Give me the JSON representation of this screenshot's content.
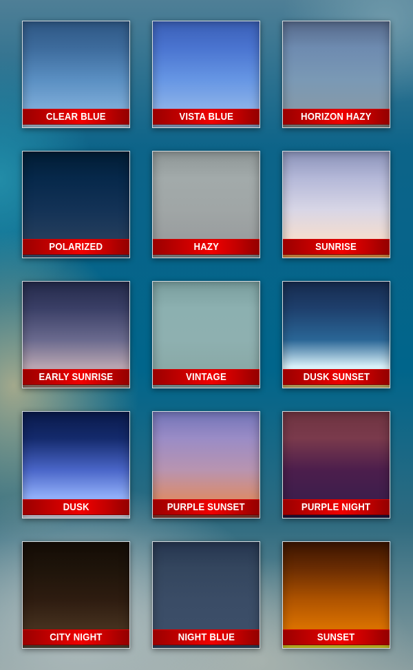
{
  "presets": [
    {
      "label": "CLEAR BLUE",
      "colors": [
        "#2e5784",
        "#3d6b9c",
        "#5a8fc2",
        "#7aa9d6",
        "#9ab2c4"
      ]
    },
    {
      "label": "VISTA BLUE",
      "colors": [
        "#3a5fb6",
        "#4a74d0",
        "#6696e4",
        "#88afe8",
        "#8298b8"
      ]
    },
    {
      "label": "HORIZON HAZY",
      "colors": [
        "#56698a",
        "#6e8bb0",
        "#7a99b5",
        "#8499aa",
        "#7c7e7c"
      ]
    },
    {
      "label": "POLARIZED",
      "colors": [
        "#021c33",
        "#06284a",
        "#133256",
        "#233d5c",
        "#334a66"
      ]
    },
    {
      "label": "HAZY",
      "colors": [
        "#8e9696",
        "#a2aaaa",
        "#a0a6a6",
        "#9a9e9f",
        "#808484"
      ]
    },
    {
      "label": "SUNRISE",
      "colors": [
        "#8a92b8",
        "#b4b8d8",
        "#d8d6e6",
        "#f2dcd0",
        "#d08a44"
      ]
    },
    {
      "label": "EARLY SUNRISE",
      "colors": [
        "#242a4a",
        "#3a3f66",
        "#6a6a8e",
        "#b8a4b0",
        "#8a7064"
      ]
    },
    {
      "label": "VINTAGE",
      "colors": [
        "#7a9e9e",
        "#8cb0b0",
        "#8eb0b0",
        "#8aaaa8",
        "#7a9898"
      ]
    },
    {
      "label": "DUSK SUNSET",
      "colors": [
        "#172b4e",
        "#1e3f6c",
        "#2a6696",
        "#d8f0f8",
        "#c0a860"
      ]
    },
    {
      "label": "DUSK",
      "colors": [
        "#0a1a4a",
        "#142a6c",
        "#4a66c8",
        "#90aef8",
        "#c4c6d2"
      ]
    },
    {
      "label": "PURPLE SUNSET",
      "colors": [
        "#7274b8",
        "#9a8cc6",
        "#b894b0",
        "#d88c70",
        "#7a3a30"
      ]
    },
    {
      "label": "PURPLE NIGHT",
      "colors": [
        "#6e3440",
        "#7a3a4c",
        "#4c1e4c",
        "#3e1e4c",
        "#1e1236"
      ]
    },
    {
      "label": "CITY NIGHT",
      "colors": [
        "#140c06",
        "#1e140a",
        "#2e1c10",
        "#44301e",
        "#4a3e30"
      ]
    },
    {
      "label": "NIGHT BLUE",
      "colors": [
        "#263650",
        "#34465e",
        "#3a4c66",
        "#3c4e68",
        "#2e3e56"
      ]
    },
    {
      "label": "SUNSET",
      "colors": [
        "#3a1400",
        "#6a2c02",
        "#b05400",
        "#d87000",
        "#c8c024"
      ]
    }
  ]
}
